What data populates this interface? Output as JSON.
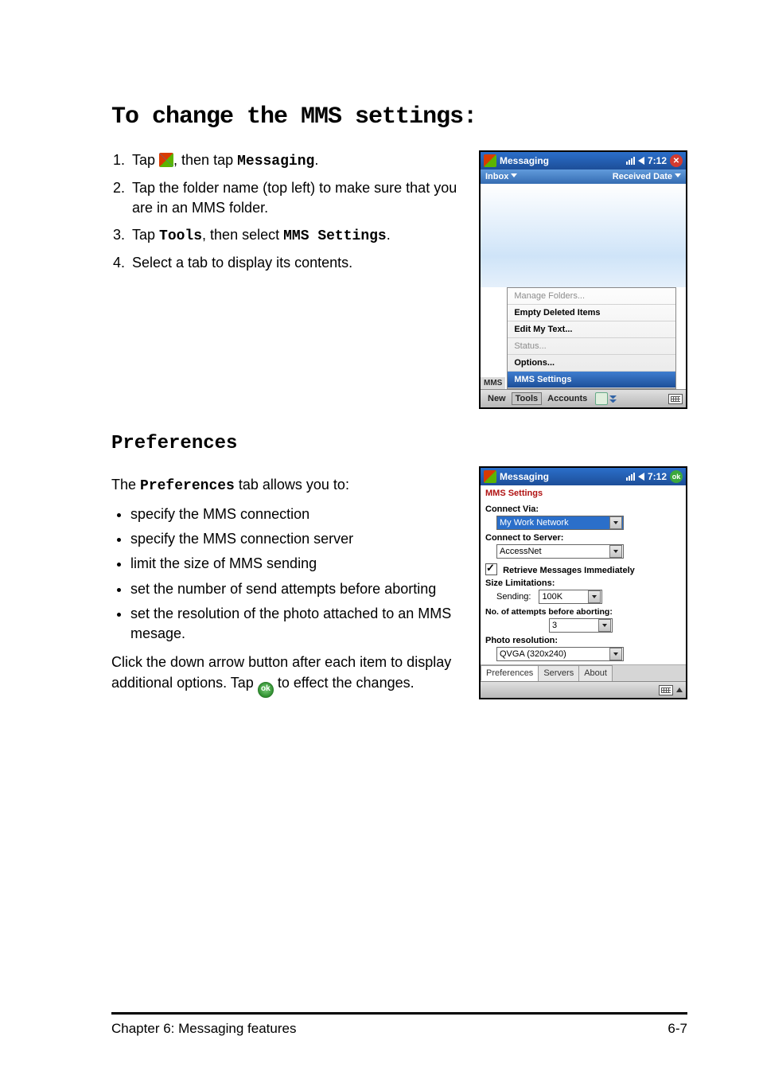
{
  "section": {
    "title": "To change the MMS settings:"
  },
  "steps": {
    "s1a": "Tap ",
    "s1b": ", then tap ",
    "s1c": "Messaging",
    "s1d": ".",
    "s2": "Tap the folder name (top left) to make sure that you are in an MMS folder.",
    "s3a": "Tap ",
    "s3b": "Tools",
    "s3c": ", then select ",
    "s3d": "MMS Settings",
    "s3e": ".",
    "s4": "Select a tab to display its contents."
  },
  "prefs": {
    "title": "Preferences",
    "intro_a": "The ",
    "intro_b": "Preferences",
    "intro_c": " tab allows you to:",
    "b1": "specify the MMS connection",
    "b2": "specify the MMS connection server",
    "b3": "limit the size of MMS sending",
    "b4": "set the number of send attempts before aborting",
    "b5": "set the resolution of the photo attached to an MMS mesage.",
    "outro_a": "Click the down arrow button after each item to display additional options. Tap ",
    "outro_b": " to effect the changes.",
    "ok_icon_text": "ok"
  },
  "phone1": {
    "title": "Messaging",
    "clock": "7:12",
    "inbox_label": "Inbox",
    "received_label": "Received Date",
    "side_tag": "MMS",
    "menu": {
      "m1": "Manage Folders...",
      "m2": "Empty Deleted Items",
      "m3": "Edit My Text...",
      "m4": "Status...",
      "m5": "Options...",
      "m6": "MMS Settings"
    },
    "bottom": {
      "b1": "New",
      "b2": "Tools",
      "b3": "Accounts"
    }
  },
  "phone2": {
    "title": "Messaging",
    "clock": "7:12",
    "ok_text": "ok",
    "heading": "MMS Settings",
    "connect_via_label": "Connect Via:",
    "connect_via_value": "My Work Network",
    "connect_server_label": "Connect to Server:",
    "connect_server_value": "AccessNet",
    "retrieve_label": "Retrieve Messages Immediately",
    "retrieve_checked": true,
    "size_label": "Size Limitations:",
    "sending_label": "Sending:",
    "sending_value": "100K",
    "attempts_label": "No. of attempts before aborting:",
    "attempts_value": "3",
    "photo_label": "Photo resolution:",
    "photo_value": "QVGA (320x240)",
    "tabs": {
      "t1": "Preferences",
      "t2": "Servers",
      "t3": "About"
    }
  },
  "footer": {
    "left": "Chapter 6: Messaging features",
    "right": "6-7"
  }
}
